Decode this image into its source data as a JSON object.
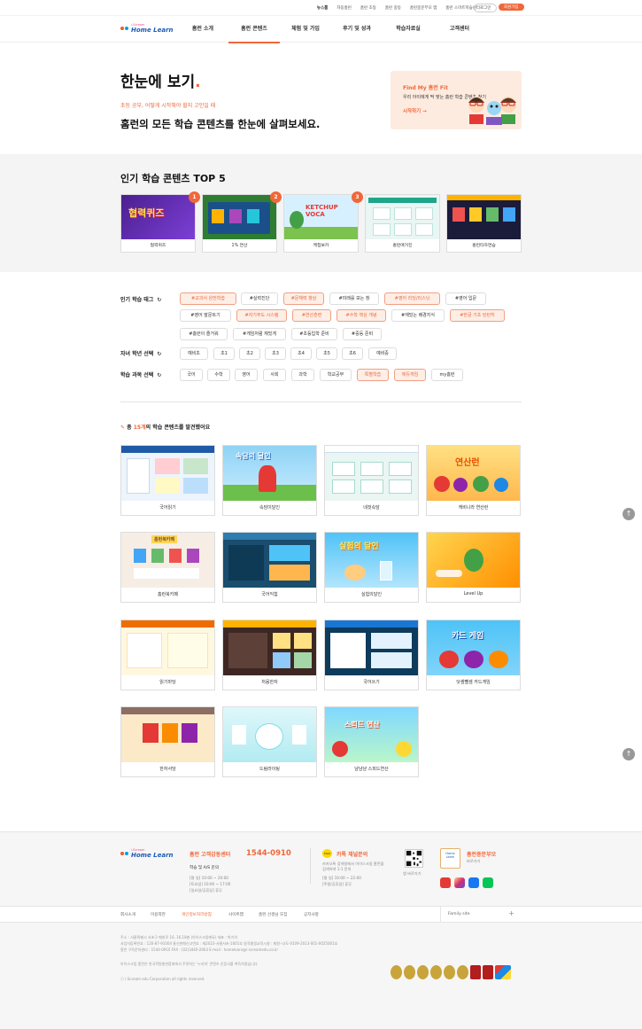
{
  "topbar": {
    "links": [
      "뉴스룸",
      "자동홈런",
      "홈런 초등",
      "홈런 중등",
      "홈런중문부모 앱",
      "홈런 스마트학습센터"
    ],
    "login": "로그인",
    "join": "회원가입"
  },
  "logo": {
    "top": "i-Scream",
    "main": "Home Learn"
  },
  "nav": [
    "홈런 소개",
    "홈런 콘텐츠",
    "체험 및 가입",
    "후기 및 성과",
    "학습자료실",
    "고객센터"
  ],
  "hero": {
    "title": "한눈에 보기",
    "dot": ".",
    "sub1": "초등 공부, 어떻게 시작해야 할지 고민일 때",
    "sub2": "홈런의 모든 학습 콘텐츠를 한눈에 살펴보세요.",
    "fit_title": "Find My 홈런 Fit",
    "fit_desc": "우리 아이에게 딱 맞는 홈런 학습 콘텐츠 찾기",
    "fit_cta": "시작하기 →"
  },
  "top5": {
    "title": "인기 학습 콘텐츠 TOP 5",
    "items": [
      {
        "rank": "1",
        "label": "협력퀴즈",
        "thumb_text": "협력퀴즈"
      },
      {
        "rank": "2",
        "label": "1% 연산",
        "thumb_text": ""
      },
      {
        "rank": "3",
        "label": "케첩보카",
        "thumb_text": "KETCHUP VOCA"
      },
      {
        "rank": "",
        "label": "홈런애거진",
        "thumb_text": ""
      },
      {
        "rank": "",
        "label": "홈런타자연습",
        "thumb_text": ""
      }
    ]
  },
  "filters": {
    "tag_label": "인기 학습 태그",
    "grade_label": "자녀 학년 선택",
    "subject_label": "학습 과목 선택",
    "refresh_icon": "↻",
    "tags_row1": [
      "#교과서 완전학습",
      "#실력진단",
      "#문해력 향상",
      "#미래를 보는 창",
      "#영어 리딩/리스닝",
      "#영어 입문"
    ],
    "tags_row2": [
      "#영어 말문트기",
      "#자기주도 시스템",
      "#연산훈련",
      "#수학 핵심 개념",
      "#재밌는 배경지식",
      "#한글 기초 탄탄히"
    ],
    "tags_row3": [
      "#홈런이 즐거워",
      "#게임처럼 재밌게",
      "#초등입학 준비",
      "#중등 준비"
    ],
    "grades": [
      "예비초",
      "초1",
      "초2",
      "초3",
      "초4",
      "초5",
      "초6",
      "예비중"
    ],
    "subjects": [
      "국어",
      "수학",
      "영어",
      "사회",
      "과학",
      "학교공부",
      "특별학습",
      "에듀게임",
      "my홈런"
    ]
  },
  "results": {
    "prefix": "총 ",
    "count": "15개",
    "suffix": "의 학습 콘텐츠를 발견했어요",
    "items": [
      {
        "label": "국어읽기",
        "thumb_text": ""
      },
      {
        "label": "속담이달인",
        "thumb_text": "속담의 달인"
      },
      {
        "label": "네컷속담",
        "thumb_text": ""
      },
      {
        "label": "캐비니라 연산런",
        "thumb_text": "연산런"
      },
      {
        "label": "홈런북카페",
        "thumb_text": "홈런북카페"
      },
      {
        "label": "국어익힘",
        "thumb_text": ""
      },
      {
        "label": "실험의달인",
        "thumb_text": "실험의 달인"
      },
      {
        "label": "Level Up",
        "thumb_text": ""
      },
      {
        "label": "읽기마당",
        "thumb_text": ""
      },
      {
        "label": "처음한자",
        "thumb_text": ""
      },
      {
        "label": "국어쓰기",
        "thumb_text": ""
      },
      {
        "label": "덧셈뺄셈 카드게임",
        "thumb_text": "카드 게임"
      },
      {
        "label": "한자서당",
        "thumb_text": ""
      },
      {
        "label": "드림라이팅",
        "thumb_text": ""
      },
      {
        "label": "냠냠냠 스피드연산",
        "thumb_text": "스피드 연산"
      }
    ]
  },
  "footer": {
    "cc_title": "홈런 고객감동센터",
    "cc_phone": "1544-0910",
    "cc_sub": "학습 및 A/S 문의",
    "cc_hours": [
      "[평 일] 10:00 ~ 20:00",
      "[토요일] 10:00 ~ 17:00",
      "[일요일/공휴일] 휴무"
    ],
    "kakao_title": "카톡 채널문의",
    "kakao_desc": [
      "카카오톡 검색창에서 아이스크림 홈런을",
      "검색하여 1:1 문의"
    ],
    "kakao_hours": [
      "[평 일] 10:00 ~ 22:00",
      "[주말/공휴일] 휴무"
    ],
    "qr_label": "앱 바로가기",
    "hb_title": "홈런중문부모",
    "hb_sub": "바로가기",
    "links": [
      "회사소개",
      "이용약관",
      "개인정보처리방침",
      "사이트맵",
      "홈런 선생님 모집",
      "공지사항"
    ],
    "family": "Family site",
    "info": [
      "주소 : 서울특별시 서초구 매헌로 16, 16,18층 (아이스크림에듀)   대표 : 박기석",
      "사업자등록번호 : 120-87-91004   통신판매신고번호 : 제2023-서울서초-1601호   원격평생교육시설 : 제원-시/도-0109-2013-001-0025001호",
      "홈런 구독문의센터 : 1544-0910   FAX : (02)3440-2663   E-mail : homelearn@i-screamedu.co.kr"
    ],
    "note": "아이스크림 홈런은 한국학원총연합회에서 주관하는 '누리미' 콘텐츠 인증서를 취득하였습니다.",
    "copyright": "ⓒ i-Scream edu Corporation all rights reserved."
  },
  "colors": {
    "accent": "#f0673a",
    "brand_blue": "#1c5bb8",
    "tag_on_bg": "#fdeee6"
  }
}
